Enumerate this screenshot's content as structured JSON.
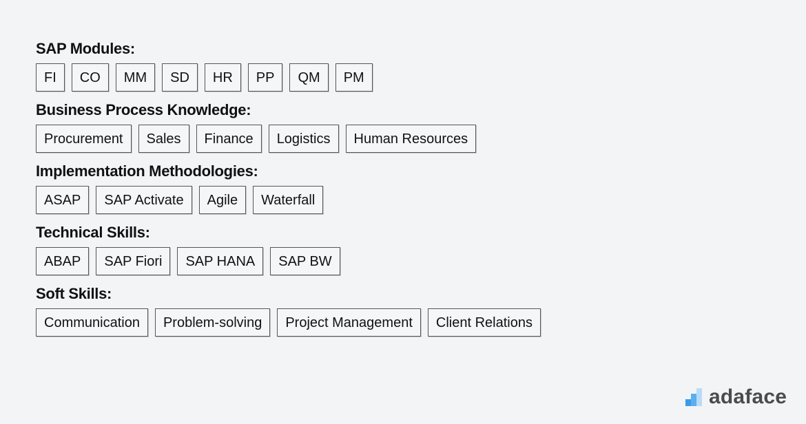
{
  "sections": [
    {
      "title": "SAP Modules:",
      "tags": [
        "FI",
        "CO",
        "MM",
        "SD",
        "HR",
        "PP",
        "QM",
        "PM"
      ]
    },
    {
      "title": "Business Process Knowledge:",
      "tags": [
        "Procurement",
        "Sales",
        "Finance",
        "Logistics",
        "Human Resources"
      ]
    },
    {
      "title": "Implementation Methodologies:",
      "tags": [
        "ASAP",
        "SAP Activate",
        "Agile",
        "Waterfall"
      ]
    },
    {
      "title": "Technical Skills:",
      "tags": [
        "ABAP",
        "SAP Fiori",
        "SAP HANA",
        "SAP BW"
      ]
    },
    {
      "title": "Soft Skills:",
      "tags": [
        "Communication",
        "Problem-solving",
        "Project Management",
        "Client Relations"
      ]
    }
  ],
  "logo": {
    "text": "adaface",
    "icon": "bar-chart-logo-icon",
    "colors": [
      "#3b9bea",
      "#b8dcf7"
    ]
  }
}
